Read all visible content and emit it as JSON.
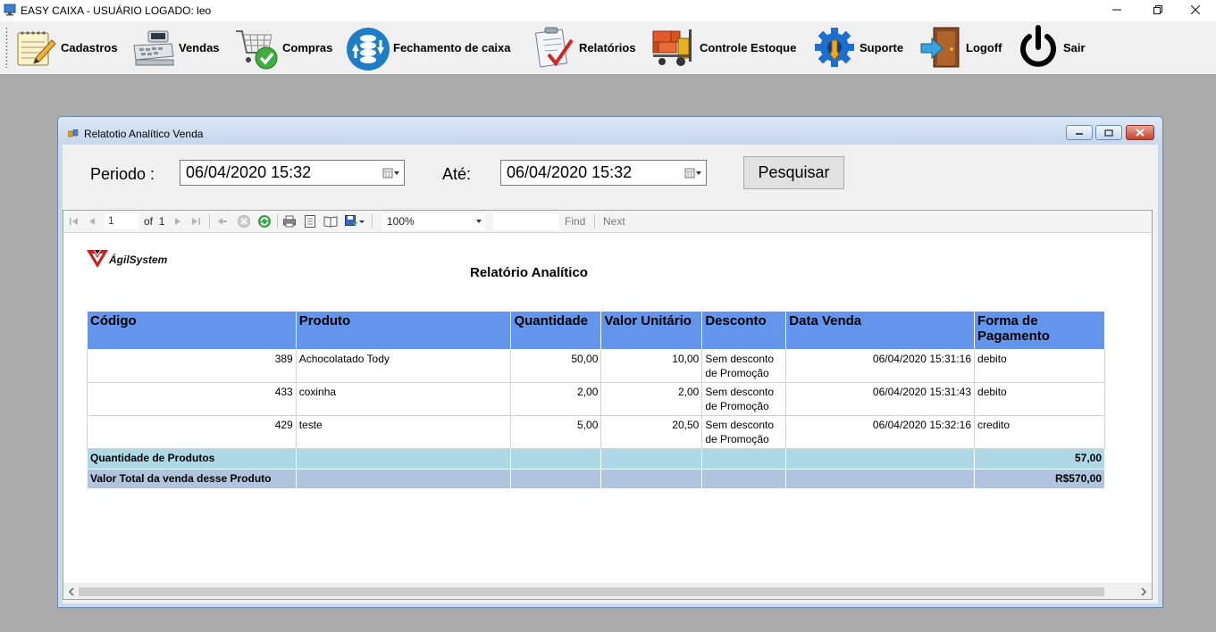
{
  "window": {
    "title": "EASY CAIXA - USUÁRIO LOGADO: leo"
  },
  "toolbar": {
    "items": [
      {
        "label": "Cadastros",
        "icon": "notepad-pencil-icon"
      },
      {
        "label": "Vendas",
        "icon": "cash-register-icon"
      },
      {
        "label": "Compras",
        "icon": "shopping-cart-check-icon"
      },
      {
        "label": "Fechamento de caixa",
        "icon": "coins-exchange-icon"
      },
      {
        "label": "Relatórios",
        "icon": "checklist-report-icon"
      },
      {
        "label": "Controle Estoque",
        "icon": "forklift-boxes-icon"
      },
      {
        "label": "Suporte",
        "icon": "gear-wrench-icon"
      },
      {
        "label": "Logoff",
        "icon": "door-exit-icon"
      },
      {
        "label": "Sair",
        "icon": "power-icon"
      }
    ]
  },
  "child_window": {
    "title": "Relatotio Analítico Venda",
    "filter": {
      "period_label": "Periodo :",
      "from_value": "06/04/2020 15:32",
      "to_label": "Até:",
      "to_value": "06/04/2020 15:32",
      "search_button": "Pesquisar"
    },
    "viewer_toolbar": {
      "current_page": "1",
      "page_of": "of",
      "total_pages": "1",
      "zoom": "100%",
      "find_label": "Find",
      "next_label": "Next"
    }
  },
  "report": {
    "logo_text": "ÁgilSystem",
    "title": "Relatório Analítico",
    "columns": [
      "Código",
      "Produto",
      "Quantidade",
      "Valor Unitário",
      "Desconto",
      "Data Venda",
      "Forma de Pagamento"
    ],
    "rows": [
      {
        "codigo": "389",
        "produto": "Achocolatado Tody",
        "quantidade": "50,00",
        "valor_unitario": "10,00",
        "desconto": "Sem desconto de Promoção",
        "data_venda": "06/04/2020 15:31:16",
        "forma_pagamento": "debito"
      },
      {
        "codigo": "433",
        "produto": "coxinha",
        "quantidade": "2,00",
        "valor_unitario": "2,00",
        "desconto": "Sem desconto de Promoção",
        "data_venda": "06/04/2020 15:31:43",
        "forma_pagamento": "debito"
      },
      {
        "codigo": "429",
        "produto": "teste",
        "quantidade": "5,00",
        "valor_unitario": "20,50",
        "desconto": "Sem desconto de Promoção",
        "data_venda": "06/04/2020 15:32:16",
        "forma_pagamento": "credito"
      }
    ],
    "summary": {
      "qty_label": "Quantidade de Produtos",
      "qty_value": "57,00",
      "total_label": "Valor Total da venda desse Produto",
      "total_value": "R$570,00"
    }
  },
  "colors": {
    "header_blue": "#6495ed",
    "summary_light": "#add8e6",
    "summary_steel": "#b0c4de",
    "logo_red": "#cc1f1f"
  }
}
